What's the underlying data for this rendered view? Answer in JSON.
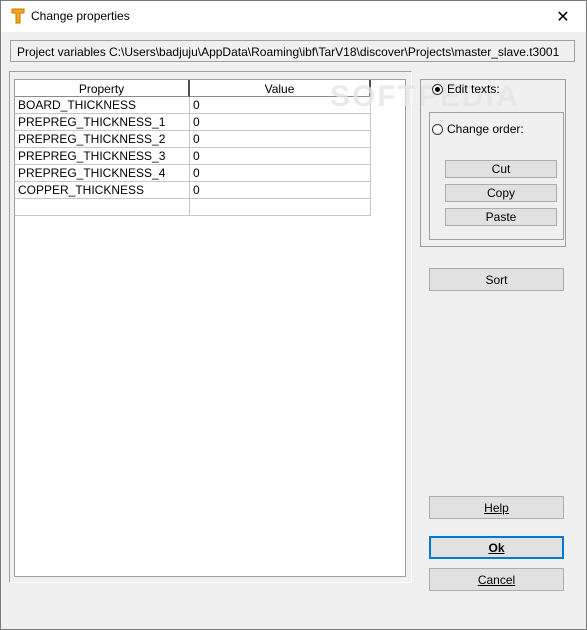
{
  "window": {
    "title": "Change properties",
    "close_glyph": "✕"
  },
  "path_bar": {
    "text": "Project variables C:\\Users\\badjuju\\AppData\\Roaming\\ibf\\TarV18\\discover\\Projects\\master_slave.t3001"
  },
  "grid": {
    "columns": [
      "Property",
      "Value"
    ],
    "rows": [
      [
        "BOARD_THICKNESS",
        "0"
      ],
      [
        "PREPREG_THICKNESS_1",
        "0"
      ],
      [
        "PREPREG_THICKNESS_2",
        "0"
      ],
      [
        "PREPREG_THICKNESS_3",
        "0"
      ],
      [
        "PREPREG_THICKNESS_4",
        "0"
      ],
      [
        "COPPER_THICKNESS",
        "0"
      ],
      [
        "",
        ""
      ]
    ]
  },
  "mode": {
    "edit_texts_label": "Edit texts:",
    "change_order_label": "Change order:",
    "selected": "edit_texts"
  },
  "order_buttons": {
    "cut": "Cut",
    "copy": "Copy",
    "paste": "Paste"
  },
  "buttons": {
    "sort": "Sort",
    "help": "Help",
    "ok": "Ok",
    "cancel": "Cancel"
  },
  "watermark": "SOFTPEDIA",
  "icons": {
    "app": "tarv-app-icon",
    "close": "close-icon"
  },
  "colors": {
    "accent": "#0078d7",
    "app_icon": "#f5a623"
  }
}
